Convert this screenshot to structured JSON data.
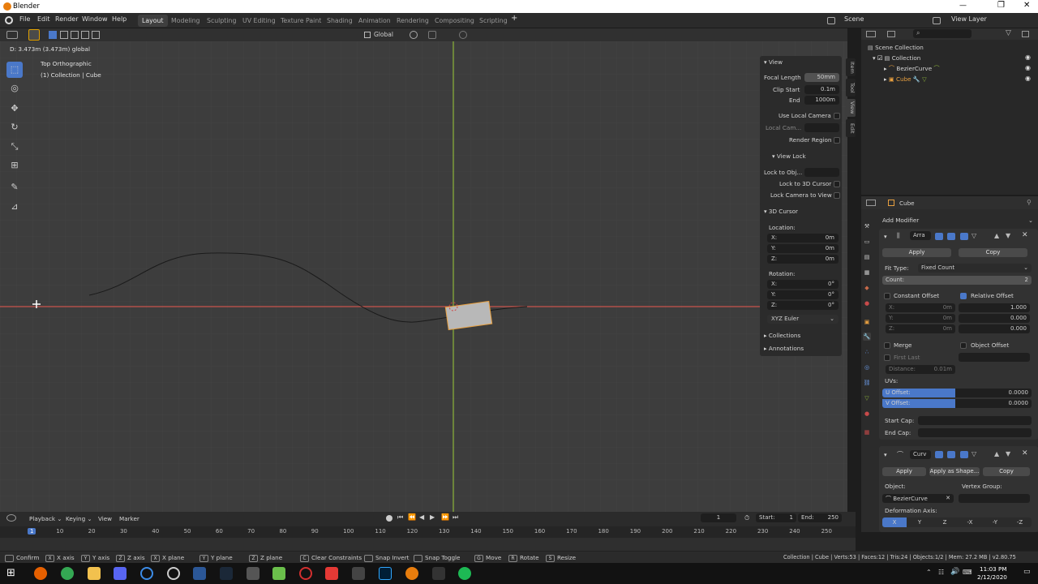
{
  "window": {
    "title": "Blender",
    "controls": [
      "—",
      "❐",
      "✕"
    ]
  },
  "menu": {
    "items": [
      "File",
      "Edit",
      "Render",
      "Window",
      "Help"
    ]
  },
  "workspaces": {
    "tabs": [
      "Layout",
      "Modeling",
      "Sculpting",
      "UV Editing",
      "Texture Paint",
      "Shading",
      "Animation",
      "Rendering",
      "Compositing",
      "Scripting"
    ],
    "active": "Layout",
    "add": "+"
  },
  "scene": {
    "label": "Scene",
    "view_layer": "View Layer"
  },
  "viewport": {
    "header_status": "D: 3.473m (3.473m) global",
    "view_name": "Top Orthographic",
    "collection_info": "(1) Collection | Cube",
    "transform_orientation": "Global"
  },
  "npanel": {
    "view_section": "View",
    "focal_length_label": "Focal Length",
    "focal_length": "50mm",
    "clip_start_label": "Clip Start",
    "clip_start": "0.1m",
    "end_label": "End",
    "end": "1000m",
    "use_local_camera": "Use Local Camera",
    "local_camera": "Local Cam...",
    "render_region": "Render Region",
    "view_lock_section": "View Lock",
    "lock_to_obj": "Lock to Obj...",
    "lock_to_3d_cursor": "Lock to 3D Cursor",
    "lock_camera_to_view": "Lock Camera to View",
    "cursor_section": "3D Cursor",
    "location_label": "Location:",
    "loc": [
      {
        "axis": "X:",
        "value": "0m"
      },
      {
        "axis": "Y:",
        "value": "0m"
      },
      {
        "axis": "Z:",
        "value": "0m"
      }
    ],
    "rotation_label": "Rotation:",
    "rot": [
      {
        "axis": "X:",
        "value": "0°"
      },
      {
        "axis": "Y:",
        "value": "0°"
      },
      {
        "axis": "Z:",
        "value": "0°"
      }
    ],
    "rotation_mode": "XYZ Euler",
    "collections": "Collections",
    "annotations": "Annotations",
    "tabs": [
      "Item",
      "Tool",
      "View",
      "Edit"
    ]
  },
  "outliner": {
    "root": "Scene Collection",
    "collection": "Collection",
    "items": [
      {
        "name": "BezierCurve"
      },
      {
        "name": "Cube"
      }
    ]
  },
  "properties": {
    "object_name": "Cube",
    "add_modifier": "Add Modifier",
    "array": {
      "name": "Arra",
      "apply": "Apply",
      "copy": "Copy",
      "fit_type_label": "Fit Type:",
      "fit_type": "Fixed Count",
      "count_label": "Count:",
      "count": "2",
      "constant_offset": "Constant Offset",
      "relative_offset": "Relative Offset",
      "const_vals": [
        {
          "axis": "X:",
          "value": "0m"
        },
        {
          "axis": "Y:",
          "value": "0m"
        },
        {
          "axis": "Z:",
          "value": "0m"
        }
      ],
      "rel_vals": [
        "1.000",
        "0.000",
        "0.000"
      ],
      "merge": "Merge",
      "first_last": "First Last",
      "object_offset": "Object Offset",
      "distance": "Distance:",
      "distance_val": "0.01m",
      "uvs": "UVs:",
      "u_offset": "U Offset:",
      "u_val": "0.0000",
      "v_offset": "V Offset:",
      "v_val": "0.0000",
      "start_cap": "Start Cap:",
      "end_cap": "End Cap:"
    },
    "curve": {
      "name": "Curv",
      "apply": "Apply",
      "apply_shape": "Apply as Shape...",
      "copy": "Copy",
      "object_label": "Object:",
      "object": "BezierCurve",
      "vertex_group": "Vertex Group:",
      "deformation_axis": "Deformation Axis:",
      "axes": [
        "X",
        "Y",
        "Z",
        "-X",
        "-Y",
        "-Z"
      ]
    }
  },
  "timeline": {
    "menus": [
      "Playback",
      "Keying",
      "View",
      "Marker"
    ],
    "current_frame": "1",
    "start_label": "Start:",
    "start": "1",
    "end_label": "End:",
    "end": "250",
    "ticks": [
      "1",
      "10",
      "20",
      "30",
      "40",
      "50",
      "60",
      "70",
      "80",
      "90",
      "100",
      "110",
      "120",
      "130",
      "140",
      "150",
      "160",
      "170",
      "180",
      "190",
      "200",
      "210",
      "220",
      "230",
      "240",
      "250"
    ]
  },
  "statusbar": {
    "hints": [
      "Confirm",
      "X axis",
      "Y axis",
      "Z axis",
      "X plane",
      "Y plane",
      "Z plane",
      "Clear Constraints",
      "Snap Invert",
      "Snap Toggle",
      "Move",
      "Rotate",
      "Resize"
    ],
    "info": "Collection | Cube | Verts:53 | Faces:12 | Tris:24 | Objects:1/2 | Mem: 27.2 MB | v2.80.75"
  },
  "taskbar": {
    "time": "11:03 PM",
    "date": "2/12/2020"
  },
  "colors": {
    "accent": "#4a78c9",
    "x_axis": "#c8544c",
    "y_axis": "#8cb33a",
    "viewport_bg": "#3d3d3d"
  }
}
